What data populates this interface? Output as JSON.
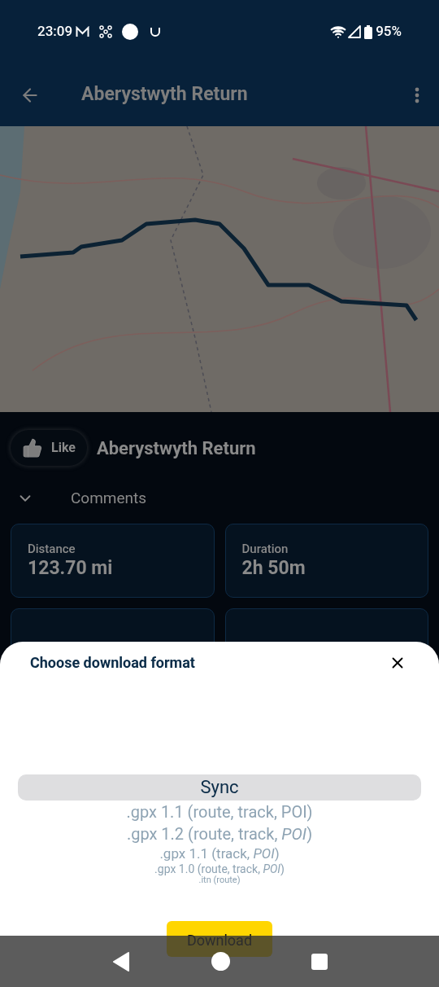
{
  "status_bar": {
    "time": "23:09",
    "battery": "95%"
  },
  "app_bar": {
    "title": "Aberystwyth Return"
  },
  "like_button": {
    "label": "Like"
  },
  "route_title": "Aberystwyth Return",
  "comments": {
    "label": "Comments",
    "expanded": false
  },
  "stats": [
    {
      "label": "Distance",
      "value": "123.70 mi"
    },
    {
      "label": "Duration",
      "value": "2h 50m"
    }
  ],
  "sheet": {
    "title": "Choose download format",
    "formats": [
      {
        "label": "Sync",
        "selected": true
      },
      {
        "label": ".gpx 1.1 (route, track, POI)",
        "selected": false
      },
      {
        "label": ".gpx 1.2 (route, track, *POI*)",
        "selected": false
      },
      {
        "label": ".gpx 1.1 (track, *POI*)",
        "selected": false
      },
      {
        "label": ".gpx 1.0 (route, track, *POI*)",
        "selected": false
      },
      {
        "label": ".itn (route)",
        "selected": false
      }
    ],
    "button": "Download"
  }
}
